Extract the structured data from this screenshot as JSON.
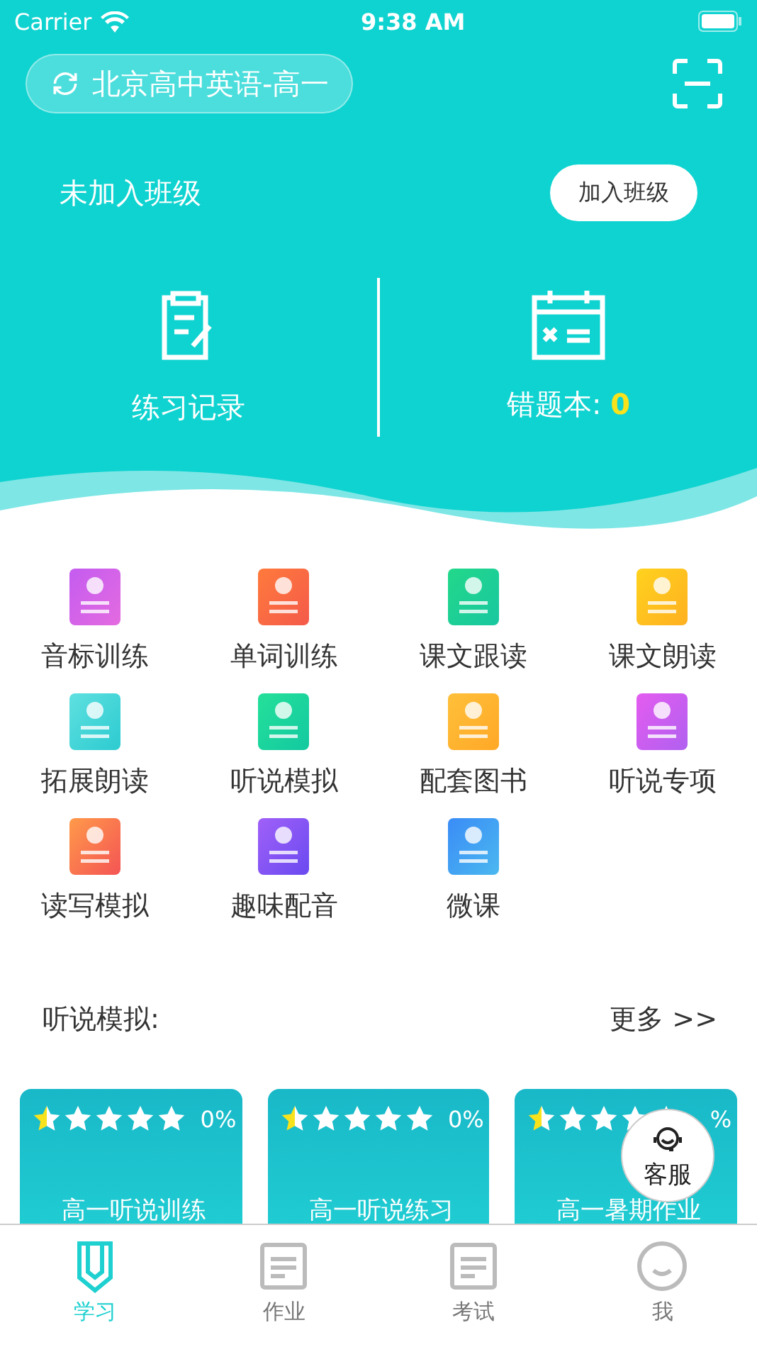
{
  "status_bar": {
    "carrier": "Carrier",
    "time": "9:38 AM"
  },
  "header": {
    "course": "北京高中英语-高一",
    "class_status": "未加入班级",
    "join_button": "加入班级"
  },
  "stats": [
    {
      "label": "练习记录"
    },
    {
      "label": "错题本:",
      "count": "0"
    }
  ],
  "features": [
    {
      "label": "音标训练"
    },
    {
      "label": "单词训练"
    },
    {
      "label": "课文跟读"
    },
    {
      "label": "课文朗读"
    },
    {
      "label": "拓展朗读"
    },
    {
      "label": "听说模拟"
    },
    {
      "label": "配套图书"
    },
    {
      "label": "听说专项"
    },
    {
      "label": "读写模拟"
    },
    {
      "label": "趣味配音"
    },
    {
      "label": "微课"
    }
  ],
  "section": {
    "title": "听说模拟:",
    "more": "更多 >>"
  },
  "cards": [
    {
      "stars": 0.5,
      "progress": "0%",
      "title": "高一听说训练"
    },
    {
      "stars": 0.5,
      "progress": "0%",
      "title": "高一听说练习"
    },
    {
      "stars": 0.5,
      "progress": "%",
      "title": "高一暑期作业"
    }
  ],
  "service_button": "客服",
  "tabs": [
    {
      "label": "学习",
      "selected": true
    },
    {
      "label": "作业",
      "selected": false
    },
    {
      "label": "考试",
      "selected": false
    },
    {
      "label": "我",
      "selected": false
    }
  ]
}
